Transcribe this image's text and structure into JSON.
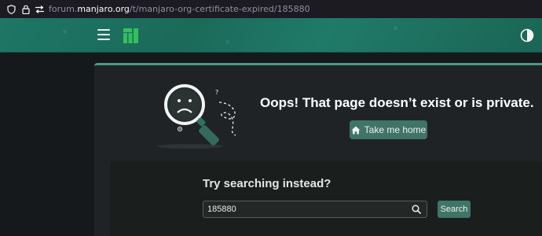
{
  "browser": {
    "url_prefix": "forum.",
    "url_host": "manjaro.org",
    "url_path": "/t/manjaro-org-certificate-expired/185880"
  },
  "header": {
    "menu_icon": "hamburger-icon",
    "logo_icon": "manjaro-logo-icon",
    "theme_icon": "theme-toggle-icon",
    "brand_color": "#1d6c5c"
  },
  "error": {
    "title": "Oops! That page doesn’t exist or is private.",
    "home_button_label": "Take me home",
    "home_icon": "home-icon"
  },
  "search": {
    "heading": "Try searching instead?",
    "input_value": "185880",
    "button_label": "Search",
    "search_icon": "search-icon"
  },
  "colors": {
    "accent": "#3f7466",
    "card_border": "#4f9785",
    "background": "#16191b"
  }
}
